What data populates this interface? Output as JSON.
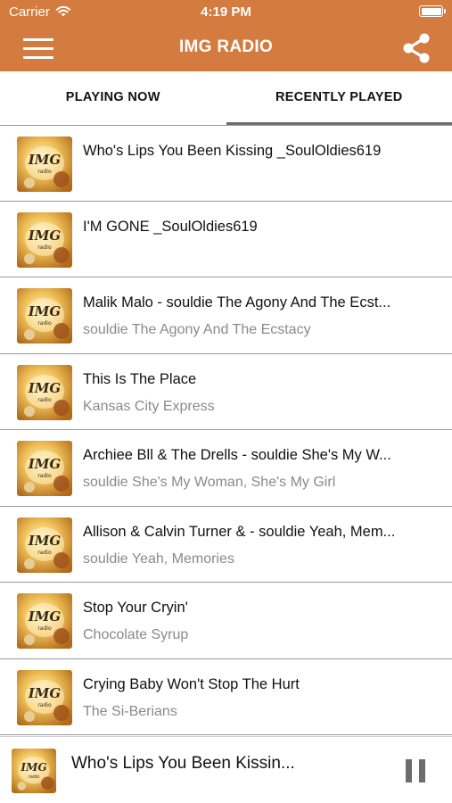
{
  "status_bar": {
    "carrier": "Carrier",
    "time": "4:19 PM"
  },
  "nav": {
    "title": "IMG RADIO"
  },
  "tabs": [
    {
      "label": "PLAYING NOW",
      "selected": false
    },
    {
      "label": "RECENTLY PLAYED",
      "selected": true
    }
  ],
  "thumbnail_logo_text": "IMG radio",
  "tracks": [
    {
      "title": "Who's Lips You Been Kissing _SoulOldies619",
      "artist": ""
    },
    {
      "title": "I'M GONE  _SoulOldies619",
      "artist": ""
    },
    {
      "title": "Malik Malo - souldie The Agony And The Ecst...",
      "artist": "souldie The Agony And The Ecstacy"
    },
    {
      "title": "This Is The Place",
      "artist": "Kansas City Express"
    },
    {
      "title": "Archiee Bll & The Drells - souldie She's My W...",
      "artist": "souldie She's My Woman, She's My Girl"
    },
    {
      "title": "Allison & Calvin Turner & - souldie Yeah, Mem...",
      "artist": "souldie Yeah, Memories"
    },
    {
      "title": "Stop Your Cryin'",
      "artist": "Chocolate Syrup"
    },
    {
      "title": "Crying Baby Won't Stop The Hurt",
      "artist": "The Si-Berians"
    }
  ],
  "now_playing": {
    "title": "Who's Lips You Been Kissin..."
  },
  "colors": {
    "accent": "#d47b3f",
    "divider": "#9a9a9a",
    "secondary_text": "#8a8a8a"
  }
}
